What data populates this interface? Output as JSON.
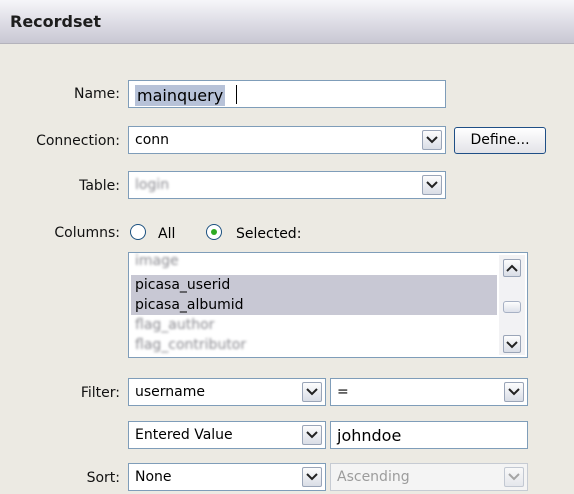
{
  "dialog": {
    "title": "Recordset"
  },
  "name": {
    "label": "Name:",
    "value": "mainquery"
  },
  "connection": {
    "label": "Connection:",
    "value": "conn",
    "define_label": "Define..."
  },
  "table": {
    "label": "Table:",
    "value": "login"
  },
  "columns": {
    "label": "Columns:",
    "all_label": "All",
    "selected_label": "Selected:",
    "selected_option": "Selected:",
    "items": [
      "image",
      "picasa_userid",
      "picasa_albumid",
      "flag_author",
      "flag_contributor"
    ]
  },
  "filter": {
    "label": "Filter:",
    "column": "username",
    "operator": "=",
    "source": "Entered Value",
    "value": "johndoe"
  },
  "sort": {
    "label": "Sort:",
    "column": "None",
    "direction": "Ascending"
  }
}
